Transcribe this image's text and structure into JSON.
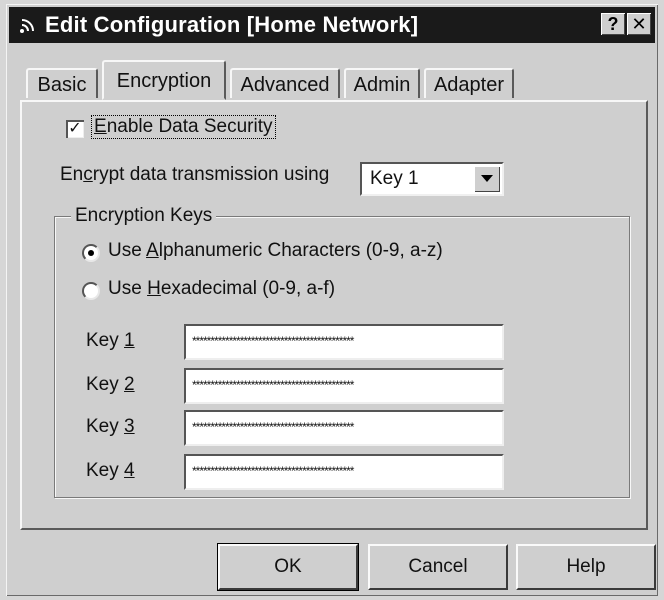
{
  "window": {
    "title": "Edit Configuration [Home Network]",
    "help_btn": "?",
    "close_btn": "✕"
  },
  "tabs": [
    {
      "label": "Basic"
    },
    {
      "label": "Encryption",
      "active": true
    },
    {
      "label": "Advanced"
    },
    {
      "label": "Admin"
    },
    {
      "label": "Adapter"
    }
  ],
  "encryption": {
    "enable_checked": true,
    "enable_label_accel": "E",
    "enable_label_rest": "nable Data Security",
    "encrypt_label_pre": "En",
    "encrypt_label_accel": "c",
    "encrypt_label_post": "rypt data transmission using",
    "encrypt_select_value": "Key 1",
    "group_title": "Encryption Keys",
    "radio_alpha_pre": "Use ",
    "radio_alpha_accel": "A",
    "radio_alpha_post": "lphanumeric Characters (0-9, a-z)",
    "radio_hex_pre": "Use ",
    "radio_hex_accel": "H",
    "radio_hex_post": "exadecimal (0-9, a-f)",
    "selected_radio": "alphanumeric",
    "keys": [
      {
        "label_pre": "Key ",
        "label_accel": "1",
        "value": "********************************************"
      },
      {
        "label_pre": "Key ",
        "label_accel": "2",
        "value": "********************************************"
      },
      {
        "label_pre": "Key ",
        "label_accel": "3",
        "value": "********************************************"
      },
      {
        "label_pre": "Key ",
        "label_accel": "4",
        "value": "********************************************"
      }
    ]
  },
  "buttons": {
    "ok": "OK",
    "cancel": "Cancel",
    "help": "Help"
  }
}
